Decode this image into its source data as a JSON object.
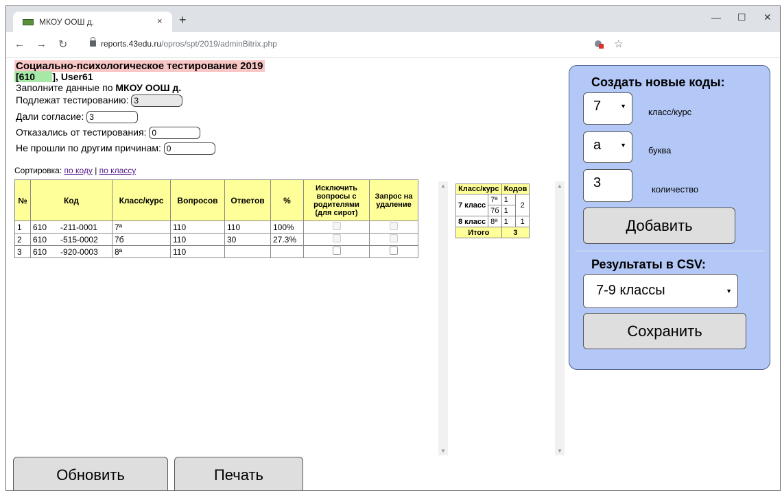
{
  "browser": {
    "tab_title": "МКОУ ООШ д.",
    "tab_close": "×",
    "new_tab": "+",
    "url_domain": "reports.43edu.ru",
    "url_path": "/opros/spt/2019/adminBitrix.php",
    "window_min": "—",
    "window_max": "☐",
    "window_close": "✕"
  },
  "header": {
    "title": "Социально-психологическое тестирование 2019",
    "code_prefix": "[610",
    "code_suffix": "], User61",
    "fill_prefix": "Заполните данные по ",
    "org": "МКОУ ООШ д."
  },
  "form": {
    "subject_label": "Подлежат тестированию:",
    "subject_value": "3",
    "consent_label": "Дали согласие:",
    "consent_value": "3",
    "refused_label": "Отказались от тестирования:",
    "refused_value": "0",
    "other_label": "Не прошли по другим причинам:",
    "other_value": "0"
  },
  "sort": {
    "label": "Сортировка:",
    "by_code": "по коду",
    "sep": "|",
    "by_class": "по классу"
  },
  "table": {
    "headers": [
      "№",
      "Код",
      "Класс/курс",
      "Вопросов",
      "Ответов",
      "%",
      "Исключить вопросы с родителями (для сирот)",
      "Запрос на удаление"
    ],
    "rows": [
      {
        "n": "1",
        "code1": "610",
        "code2": "-211-0001",
        "cls": "7ª",
        "questions": "110",
        "answers": "110",
        "pct": "100%"
      },
      {
        "n": "2",
        "code1": "610",
        "code2": "-515-0002",
        "cls": "7б",
        "questions": "110",
        "answers": "30",
        "pct": "27.3%"
      },
      {
        "n": "3",
        "code1": "610",
        "code2": "-920-0003",
        "cls": "8ª",
        "questions": "110",
        "answers": "",
        "pct": ""
      }
    ]
  },
  "summary": {
    "h_class": "Класс/курс",
    "h_codes": "Кодов",
    "grade7": "7 класс",
    "g7a": "7ª",
    "g7a_n": "1",
    "g7b": "7б",
    "g7b_n": "1",
    "g7_total": "2",
    "grade8": "8 класс",
    "g8a": "8ª",
    "g8a_n": "1",
    "g8_total": "1",
    "total_label": "Итого",
    "total": "3"
  },
  "panel": {
    "create_title": "Создать новые коды:",
    "grade_value": "7",
    "grade_label": "класс/курс",
    "letter_value": "а",
    "letter_label": "буква",
    "count_value": "3",
    "count_label": "количество",
    "add_button": "Добавить",
    "csv_title": "Результаты в CSV:",
    "csv_value": "7-9 классы",
    "save_button": "Сохранить"
  },
  "bottom": {
    "refresh": "Обновить",
    "print": "Печать"
  }
}
